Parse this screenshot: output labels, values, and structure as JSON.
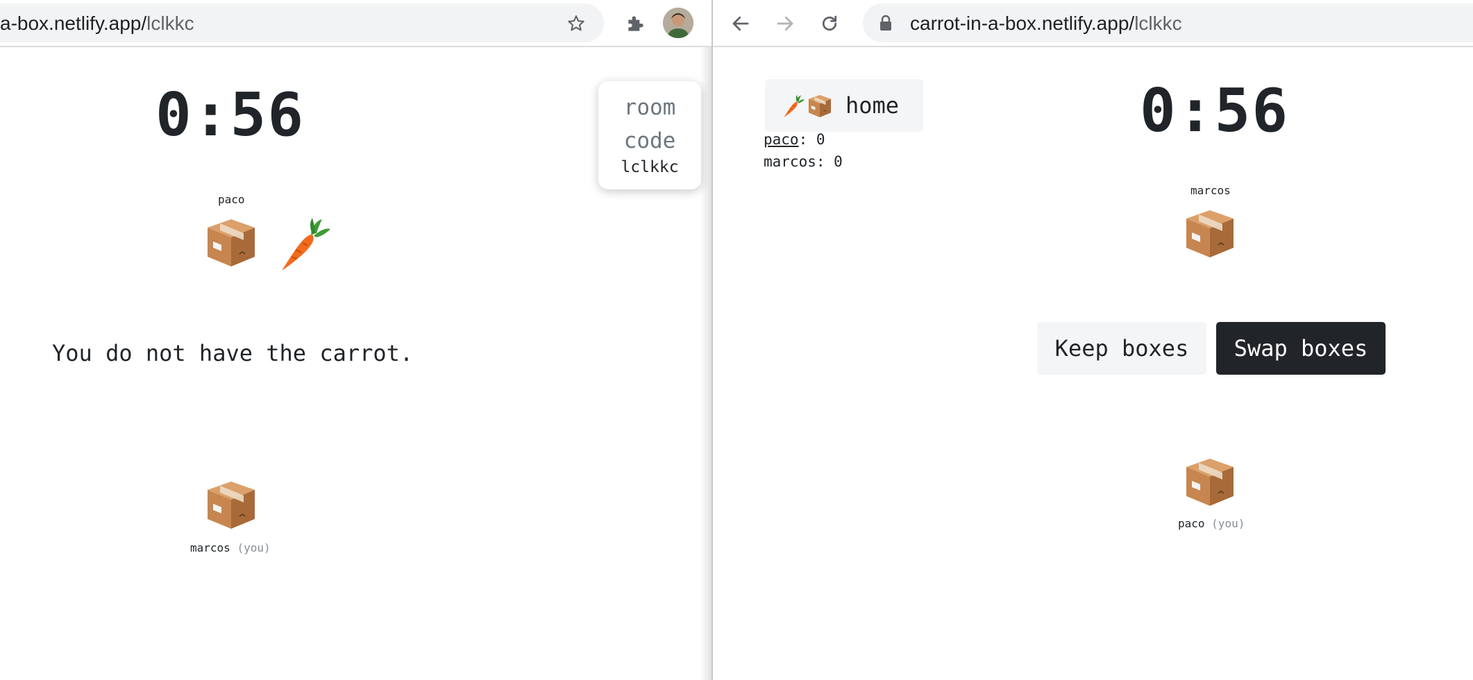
{
  "left": {
    "url_host": "a-box.netlify.app/",
    "url_path": "lclkkc",
    "timer": "0:56",
    "opponent_name": "paco",
    "message": "You do not have the carrot.",
    "self_name": "marcos",
    "you_tag": "(you)",
    "room_code_label_1": "room",
    "room_code_label_2": "code",
    "room_code": "lclkkc"
  },
  "right": {
    "url_host": "carrot-in-a-box.netlify.app/",
    "url_path": "lclkkc",
    "home_label": "home",
    "scores": [
      {
        "name": "paco",
        "score": ": 0"
      },
      {
        "name": "marcos",
        "score": ": 0"
      }
    ],
    "timer": "0:56",
    "opponent_name": "marcos",
    "keep_label": "Keep boxes",
    "swap_label": "Swap boxes",
    "self_name": "paco",
    "you_tag": "(you)"
  },
  "icons": {
    "star": "star-icon",
    "extensions": "puzzle-icon",
    "avatar": "avatar",
    "back": "back-arrow-icon",
    "forward": "forward-arrow-icon",
    "reload": "reload-icon",
    "lock": "lock-icon",
    "carrot": "carrot-icon",
    "box": "box-icon"
  },
  "colors": {
    "dark_button": "#212529",
    "light_button": "#f4f5f7",
    "omnibox": "#f1f3f4",
    "carrot": "#f26b1d",
    "box": "#c9884e"
  }
}
